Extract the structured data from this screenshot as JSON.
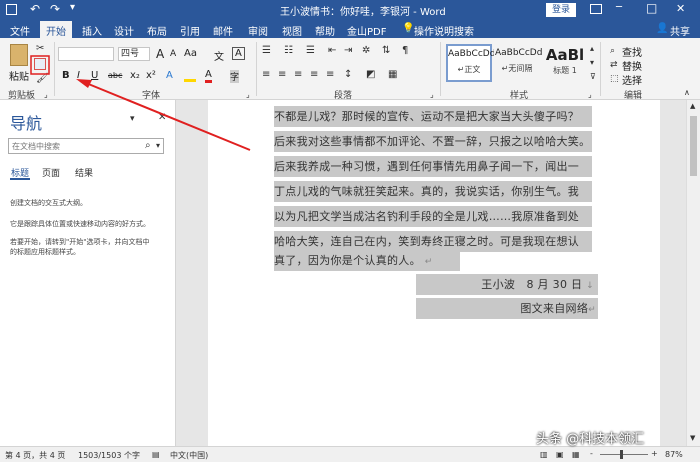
{
  "titlebar": {
    "title": "王小波情书：你好哇，李银河 - Word",
    "login": "登录",
    "min": "─",
    "restore": "❐",
    "max": "□",
    "close": "✕"
  },
  "tabs": {
    "file": "文件",
    "home": "开始",
    "insert": "插入",
    "design": "设计",
    "layout": "布局",
    "references": "引用",
    "mailings": "邮件",
    "review": "审阅",
    "view": "视图",
    "help": "帮助",
    "jinshan": "金山PDF",
    "tellme": "操作说明搜索",
    "share": "共享"
  },
  "ribbon": {
    "clipboard": {
      "paste": "粘贴",
      "label": "剪贴板"
    },
    "font": {
      "size": "四号",
      "label": "字体",
      "bold": "B",
      "italic": "I",
      "underline": "U",
      "strike": "abc",
      "sub": "x₂",
      "sup": "x²",
      "grow": "A",
      "shrink": "A",
      "color_a": "A",
      "aa": "Aa",
      "wen": "文",
      "a_box": "A",
      "a_circ": "字"
    },
    "paragraph": {
      "label": "段落"
    },
    "styles": {
      "label": "样式",
      "items": [
        {
          "preview": "AaBbCcDd",
          "name": "↵正文"
        },
        {
          "preview": "AaBbCcDd",
          "name": "↵无间隔"
        },
        {
          "preview": "AaBl",
          "name": "标题 1"
        }
      ]
    },
    "editing": {
      "find": "查找",
      "replace": "替换",
      "select": "选择",
      "label": "编辑"
    }
  },
  "nav": {
    "title": "导航",
    "search_placeholder": "在文档中搜索",
    "tabs": [
      "标题",
      "页面",
      "结果"
    ],
    "hint1": "创建文档的交互式大纲。",
    "hint2": "它是跟踪具体位置或快速移动内容的好方式。",
    "hint3a": "若要开始，请转到\"开始\"选项卡，并向文档中",
    "hint3b": "的标题应用标题样式。"
  },
  "document": {
    "lines": [
      "不都是儿戏？那时候的宣传、运动不是把大家当大头傻子吗？",
      "后来我对这些事情都不加评论、不置一辞，只报之以哈哈大笑。",
      "后来我养成一种习惯，遇到任何事情先用鼻子闻一下，闻出一",
      "丁点儿戏的气味就狂笑起来。真的，我说实话，你别生气。我",
      "以为凡把文学当成沽名钓利手段的全是儿戏……我原准备到处",
      "哈哈大笑，连自己在内，笑到寿终正寝之时。可是我现在想认",
      "真了，因为你是个认真的人。"
    ],
    "signature": "王小波　8 月 30 日",
    "source": "图文来自网络"
  },
  "status": {
    "page": "第 4 页，共 4 页",
    "words": "1503/1503 个字",
    "lang": "中文(中国)",
    "zoom": "87%",
    "minus": "-",
    "plus": "+"
  },
  "watermark": "头条 @科技本领汇"
}
